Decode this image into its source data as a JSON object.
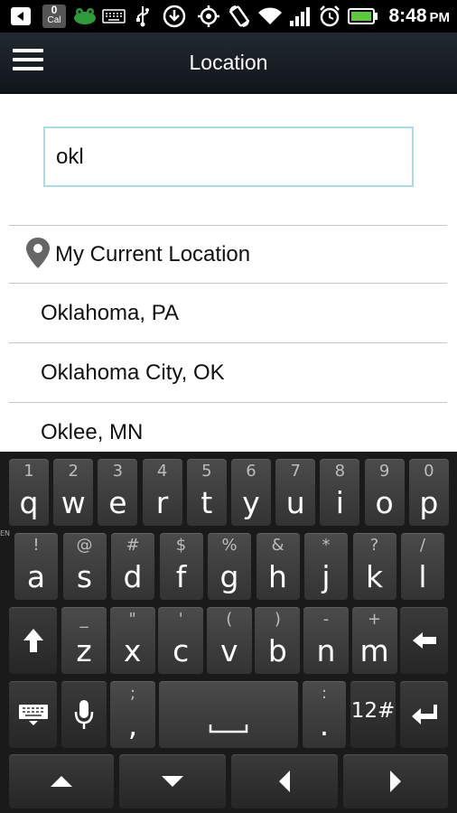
{
  "status_bar": {
    "time": "8:48",
    "ampm": "PM",
    "calendar_badge": {
      "count": "0",
      "label": "Cal"
    },
    "icons": [
      "back-icon",
      "calendar-badge-icon",
      "frog-icon",
      "keyboard-icon",
      "usb-icon",
      "download-icon",
      "gps-icon",
      "rotate-icon",
      "wifi-icon",
      "signal-icon",
      "alarm-icon",
      "battery-icon"
    ]
  },
  "action_bar": {
    "title": "Location",
    "menu_icon": "hamburger-menu-icon"
  },
  "search": {
    "value": "okl"
  },
  "results": {
    "current_location": "My Current Location",
    "items": [
      "Oklahoma, PA",
      "Oklahoma City, OK",
      "Oklee, MN"
    ]
  },
  "keyboard": {
    "row1": [
      {
        "hint": "1",
        "key": "q"
      },
      {
        "hint": "2",
        "key": "w"
      },
      {
        "hint": "3",
        "key": "e"
      },
      {
        "hint": "4",
        "key": "r"
      },
      {
        "hint": "5",
        "key": "t"
      },
      {
        "hint": "6",
        "key": "y"
      },
      {
        "hint": "7",
        "key": "u"
      },
      {
        "hint": "8",
        "key": "i"
      },
      {
        "hint": "9",
        "key": "o"
      },
      {
        "hint": "0",
        "key": "p"
      }
    ],
    "row2": [
      {
        "hint": "!",
        "key": "a"
      },
      {
        "hint": "@",
        "key": "s"
      },
      {
        "hint": "#",
        "key": "d"
      },
      {
        "hint": "$",
        "key": "f"
      },
      {
        "hint": "%",
        "key": "g"
      },
      {
        "hint": "&",
        "key": "h"
      },
      {
        "hint": "*",
        "key": "j"
      },
      {
        "hint": "?",
        "key": "k"
      },
      {
        "hint": "/",
        "key": "l"
      }
    ],
    "row3": [
      {
        "hint": "_",
        "key": "z"
      },
      {
        "hint": "\"",
        "key": "x"
      },
      {
        "hint": "'",
        "key": "c"
      },
      {
        "hint": "(",
        "key": "v"
      },
      {
        "hint": ")",
        "key": "b"
      },
      {
        "hint": "-",
        "key": "n"
      },
      {
        "hint": "+",
        "key": "m"
      }
    ],
    "comma_key": {
      "hint": ";",
      "key": ","
    },
    "period_key": {
      "hint": ":",
      "key": "."
    },
    "symbols_key": "12#",
    "side_mark": "EN",
    "icons": {
      "shift": "shift-arrow-icon",
      "backspace": "backspace-arrow-icon",
      "keyboard_settings": "keyboard-settings-icon",
      "mic": "microphone-icon",
      "space": "space-bar-icon",
      "enter": "enter-return-icon",
      "up": "cursor-up-icon",
      "down": "cursor-down-icon",
      "left": "cursor-left-icon",
      "right": "cursor-right-icon"
    }
  }
}
